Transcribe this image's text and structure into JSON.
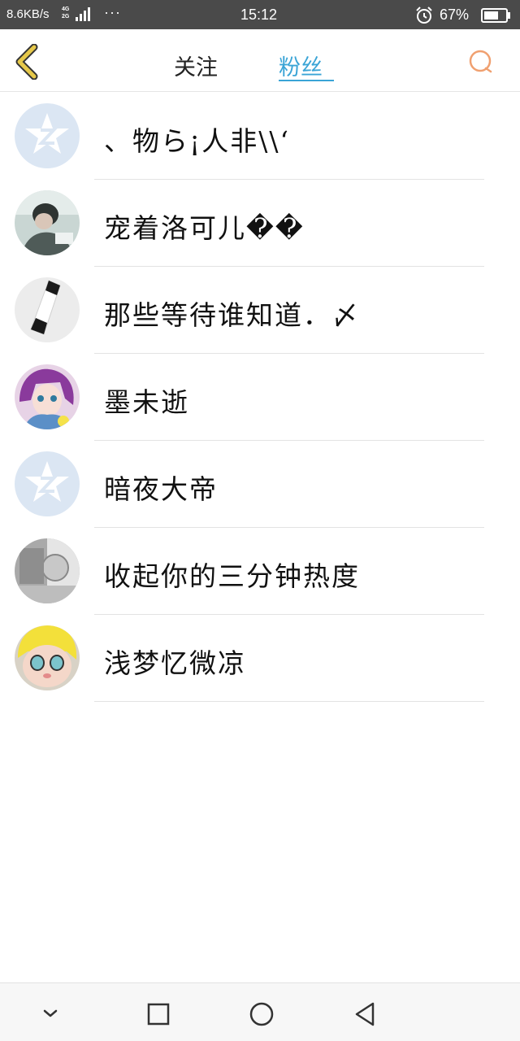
{
  "status_bar": {
    "speed": "8.6KB/s",
    "net_top": "4G",
    "net_bottom": "2G",
    "dots": "···",
    "time": "15:12",
    "battery_pct": "67%",
    "battery_level": 0.67,
    "icons": [
      "signal-icon",
      "alarm-icon",
      "battery-icon"
    ]
  },
  "header": {
    "back_icon": "chevron-left-icon",
    "tabs": [
      {
        "label": "关注",
        "active": false
      },
      {
        "label": "粉丝",
        "active": true
      }
    ],
    "search_icon": "search-icon"
  },
  "fans": [
    {
      "name": "、物ら¡人非\\\\‘",
      "avatar": "default-qzone-avatar"
    },
    {
      "name": "宠着洛可儿��",
      "avatar": "photo-avatar"
    },
    {
      "name": "那些等待谁知道．〆",
      "avatar": "photo-avatar"
    },
    {
      "name": "墨未逝",
      "avatar": "anime-avatar"
    },
    {
      "name": "暗夜大帝",
      "avatar": "default-qzone-avatar"
    },
    {
      "name": "收起你的三分钟热度",
      "avatar": "photo-avatar"
    },
    {
      "name": "浅梦忆微凉",
      "avatar": "doll-avatar"
    }
  ],
  "nav_bar": {
    "icons": [
      "chevron-down-icon",
      "recent-apps-icon",
      "home-icon",
      "back-triangle-icon"
    ]
  },
  "colors": {
    "accent": "#3aa4d6",
    "back_arrow": "#e6c84a",
    "search": "#f0a070",
    "status_bar_bg": "#4a4a4a"
  }
}
